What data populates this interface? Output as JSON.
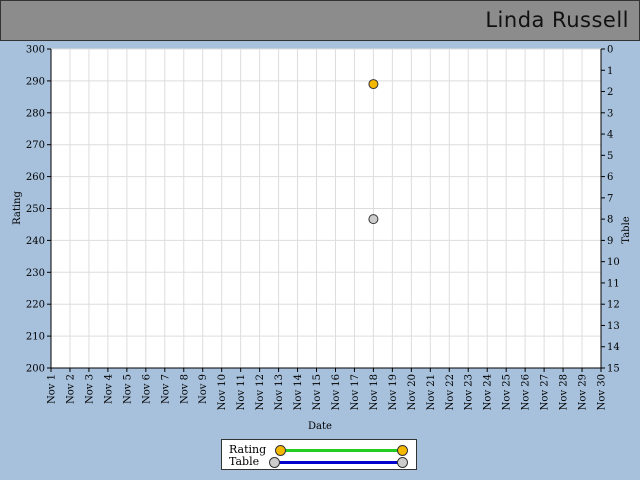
{
  "header": {
    "user_name": "Linda Russell"
  },
  "colors": {
    "background": "#a7c1dc",
    "header": "#8c8c8c",
    "rating_marker": "#f5b800",
    "table_marker": "#cccccc",
    "rating_line": "#22cc22",
    "table_line": "#0000cc"
  },
  "chart_data": {
    "type": "scatter",
    "xlabel": "Date",
    "ylabel": "Rating",
    "y2label": "Table",
    "categories": [
      "Nov 1",
      "Nov 2",
      "Nov 3",
      "Nov 4",
      "Nov 5",
      "Nov 6",
      "Nov 7",
      "Nov 8",
      "Nov 9",
      "Nov 10",
      "Nov 11",
      "Nov 12",
      "Nov 13",
      "Nov 14",
      "Nov 15",
      "Nov 16",
      "Nov 17",
      "Nov 18",
      "Nov 19",
      "Nov 20",
      "Nov 21",
      "Nov 22",
      "Nov 23",
      "Nov 24",
      "Nov 25",
      "Nov 26",
      "Nov 27",
      "Nov 28",
      "Nov 29",
      "Nov 30"
    ],
    "ylim": [
      200,
      300
    ],
    "yticks": [
      200,
      210,
      220,
      230,
      240,
      250,
      260,
      270,
      280,
      290,
      300
    ],
    "y2lim": [
      0,
      15
    ],
    "y2_inverted": true,
    "y2ticks": [
      0,
      1,
      2,
      3,
      4,
      5,
      6,
      7,
      8,
      9,
      10,
      11,
      12,
      13,
      14,
      15
    ],
    "grid": true,
    "legend_position": "bottom",
    "series": [
      {
        "name": "Rating",
        "axis": "left",
        "points": [
          {
            "x": "Nov 18",
            "y": 289
          }
        ]
      },
      {
        "name": "Table",
        "axis": "right",
        "points": [
          {
            "x": "Nov 18",
            "y": 8
          }
        ]
      }
    ]
  }
}
